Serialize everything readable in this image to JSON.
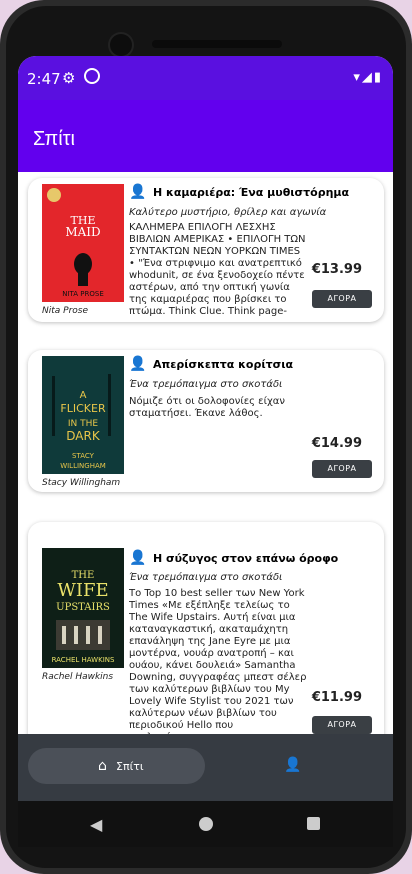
{
  "status_bar": {
    "time": "2:47"
  },
  "app_bar": {
    "title": "Σπίτι"
  },
  "books": [
    {
      "title": "Η καμαριέρα: Ένα μυθιστόρημα",
      "subtitle": "Καλύτερο μυστήριο, θρίλερ και αγωνία",
      "description": "ΚΑΛΗΜΕΡΑ ΕΠΙΛΟΓΗ ΛΕΣΧΗΣ ΒΙΒΛΙΩΝ ΑΜΕΡΙΚΑΣ • ΕΠΙΛΟΓΗ ΤΩΝ ΣΥΝΤΑΚΤΩΝ ΝΕΩΝ ΥΟΡΚΩΝ TIMES • \"Ένα στριφνιμο και ανατρεπτικό whodunit, σε ένα ξενοδοχείο πέντε αστέρων, από την οπτική γωνία της καμαριέρας που βρίσκει το πτώμα. Think Clue. Think page-turner .'-Αίγλη'",
      "author": "Nita Prose",
      "price": "€13.99",
      "buy": "ΑΓΟΡΑ",
      "cover": {
        "title": "THE MAID",
        "author": "NITA PROSE",
        "bg": "#e3262b"
      }
    },
    {
      "title": "Απερίσκεπτα κορίτσια",
      "subtitle": "Ένα τρεμόπαιγμα στο σκοτάδι",
      "description": "Νόμιζε ότι οι δολοφονίες είχαν σταματήσει. Έκανε λάθος.",
      "author": "Stacy Willingham",
      "price": "€14.99",
      "buy": "ΑΓΟΡΑ",
      "cover": {
        "title1": "A FLICKER",
        "title2": "IN THE",
        "title3": "DARK",
        "author": "STACY WILLINGHAM",
        "bg": "#0f3a3a"
      }
    },
    {
      "title": "Η σύζυγος στον επάνω όροφο",
      "subtitle": "Ένα τρεμόπαιγμα στο σκοτάδι",
      "description": "Το Top 10 best seller των New York Times «Με εξέπληξε τελείως το The Wife Upstairs. Αυτή είναι μια καταναγκαστική, ακαταμάχητη επανάληψη της Jane Eyre με μια μοντέρνα, νουάρ ανατροπή – και ουάου, κάνει δουλειά» Samantha Downing, συγγραφέας μπεστ σέλερ των καλύτερων βιβλίων του My Lovely Wife Stylist του 2021 των καλύτερων νέων βιβλίων του περιοδικού Hello που κυκλοφόρησαν",
      "author": "Rachel Hawkins",
      "price": "€11.99",
      "buy": "ΑΓΟΡΑ",
      "cover": {
        "title1": "THE",
        "title2": "WIFE",
        "title3": "UPSTAIRS",
        "author": "RACHEL HAWKINS",
        "bg": "#0e1f17"
      }
    }
  ],
  "bottom_nav": {
    "home_label": "Σπίτι"
  },
  "colors": {
    "primary": "#6200ee",
    "status": "#5a10e0",
    "button": "#3a3f44",
    "bottom_bar": "#363b42"
  }
}
